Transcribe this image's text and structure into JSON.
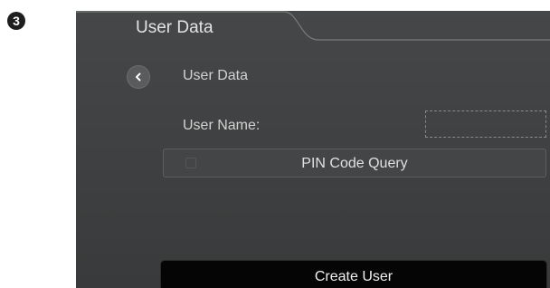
{
  "step_number": "3",
  "window": {
    "title": "User Data"
  },
  "page": {
    "heading": "User Data"
  },
  "form": {
    "user_name_label": "User Name:",
    "user_name_value": "",
    "pin_code_query_label": "PIN Code Query",
    "pin_code_query_checked": false
  },
  "actions": {
    "create_user_label": "Create User"
  },
  "icons": {
    "back": "chevron-left-icon"
  }
}
